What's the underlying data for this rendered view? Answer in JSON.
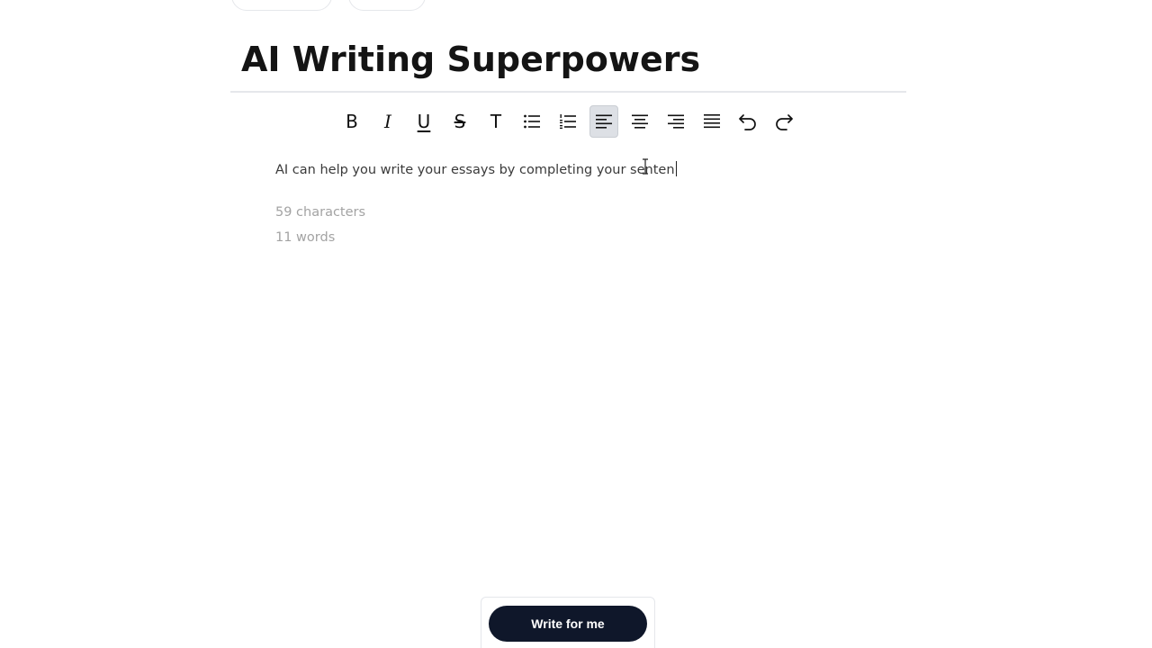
{
  "document": {
    "title": "AI Writing Superpowers",
    "body_text": "AI can help you write your essays by completing your senten"
  },
  "toolbar": {
    "buttons": [
      {
        "name": "bold",
        "glyph": "B",
        "icon": "bold-icon"
      },
      {
        "name": "italic",
        "glyph": "I",
        "icon": "italic-icon"
      },
      {
        "name": "underline",
        "glyph": "U",
        "icon": "underline-icon"
      },
      {
        "name": "strikethrough",
        "glyph": "S",
        "icon": "strikethrough-icon"
      },
      {
        "name": "text",
        "glyph": "T",
        "icon": "text-icon"
      },
      {
        "name": "bullet-list",
        "icon": "bullet-list-icon"
      },
      {
        "name": "numbered-list",
        "icon": "numbered-list-icon"
      },
      {
        "name": "align-left",
        "icon": "align-left-icon",
        "active": true
      },
      {
        "name": "align-center",
        "icon": "align-center-icon"
      },
      {
        "name": "align-right",
        "icon": "align-right-icon"
      },
      {
        "name": "align-justify",
        "icon": "align-justify-icon"
      },
      {
        "name": "undo",
        "icon": "undo-icon"
      },
      {
        "name": "redo",
        "icon": "redo-icon"
      }
    ]
  },
  "stats": {
    "characters": "59 characters",
    "words": "11 words"
  },
  "actions": {
    "write_label": "Write for me"
  },
  "colors": {
    "primary_button": "#0f172a",
    "active_tool": "#dde0e5",
    "muted_text": "#a3a3a3"
  }
}
